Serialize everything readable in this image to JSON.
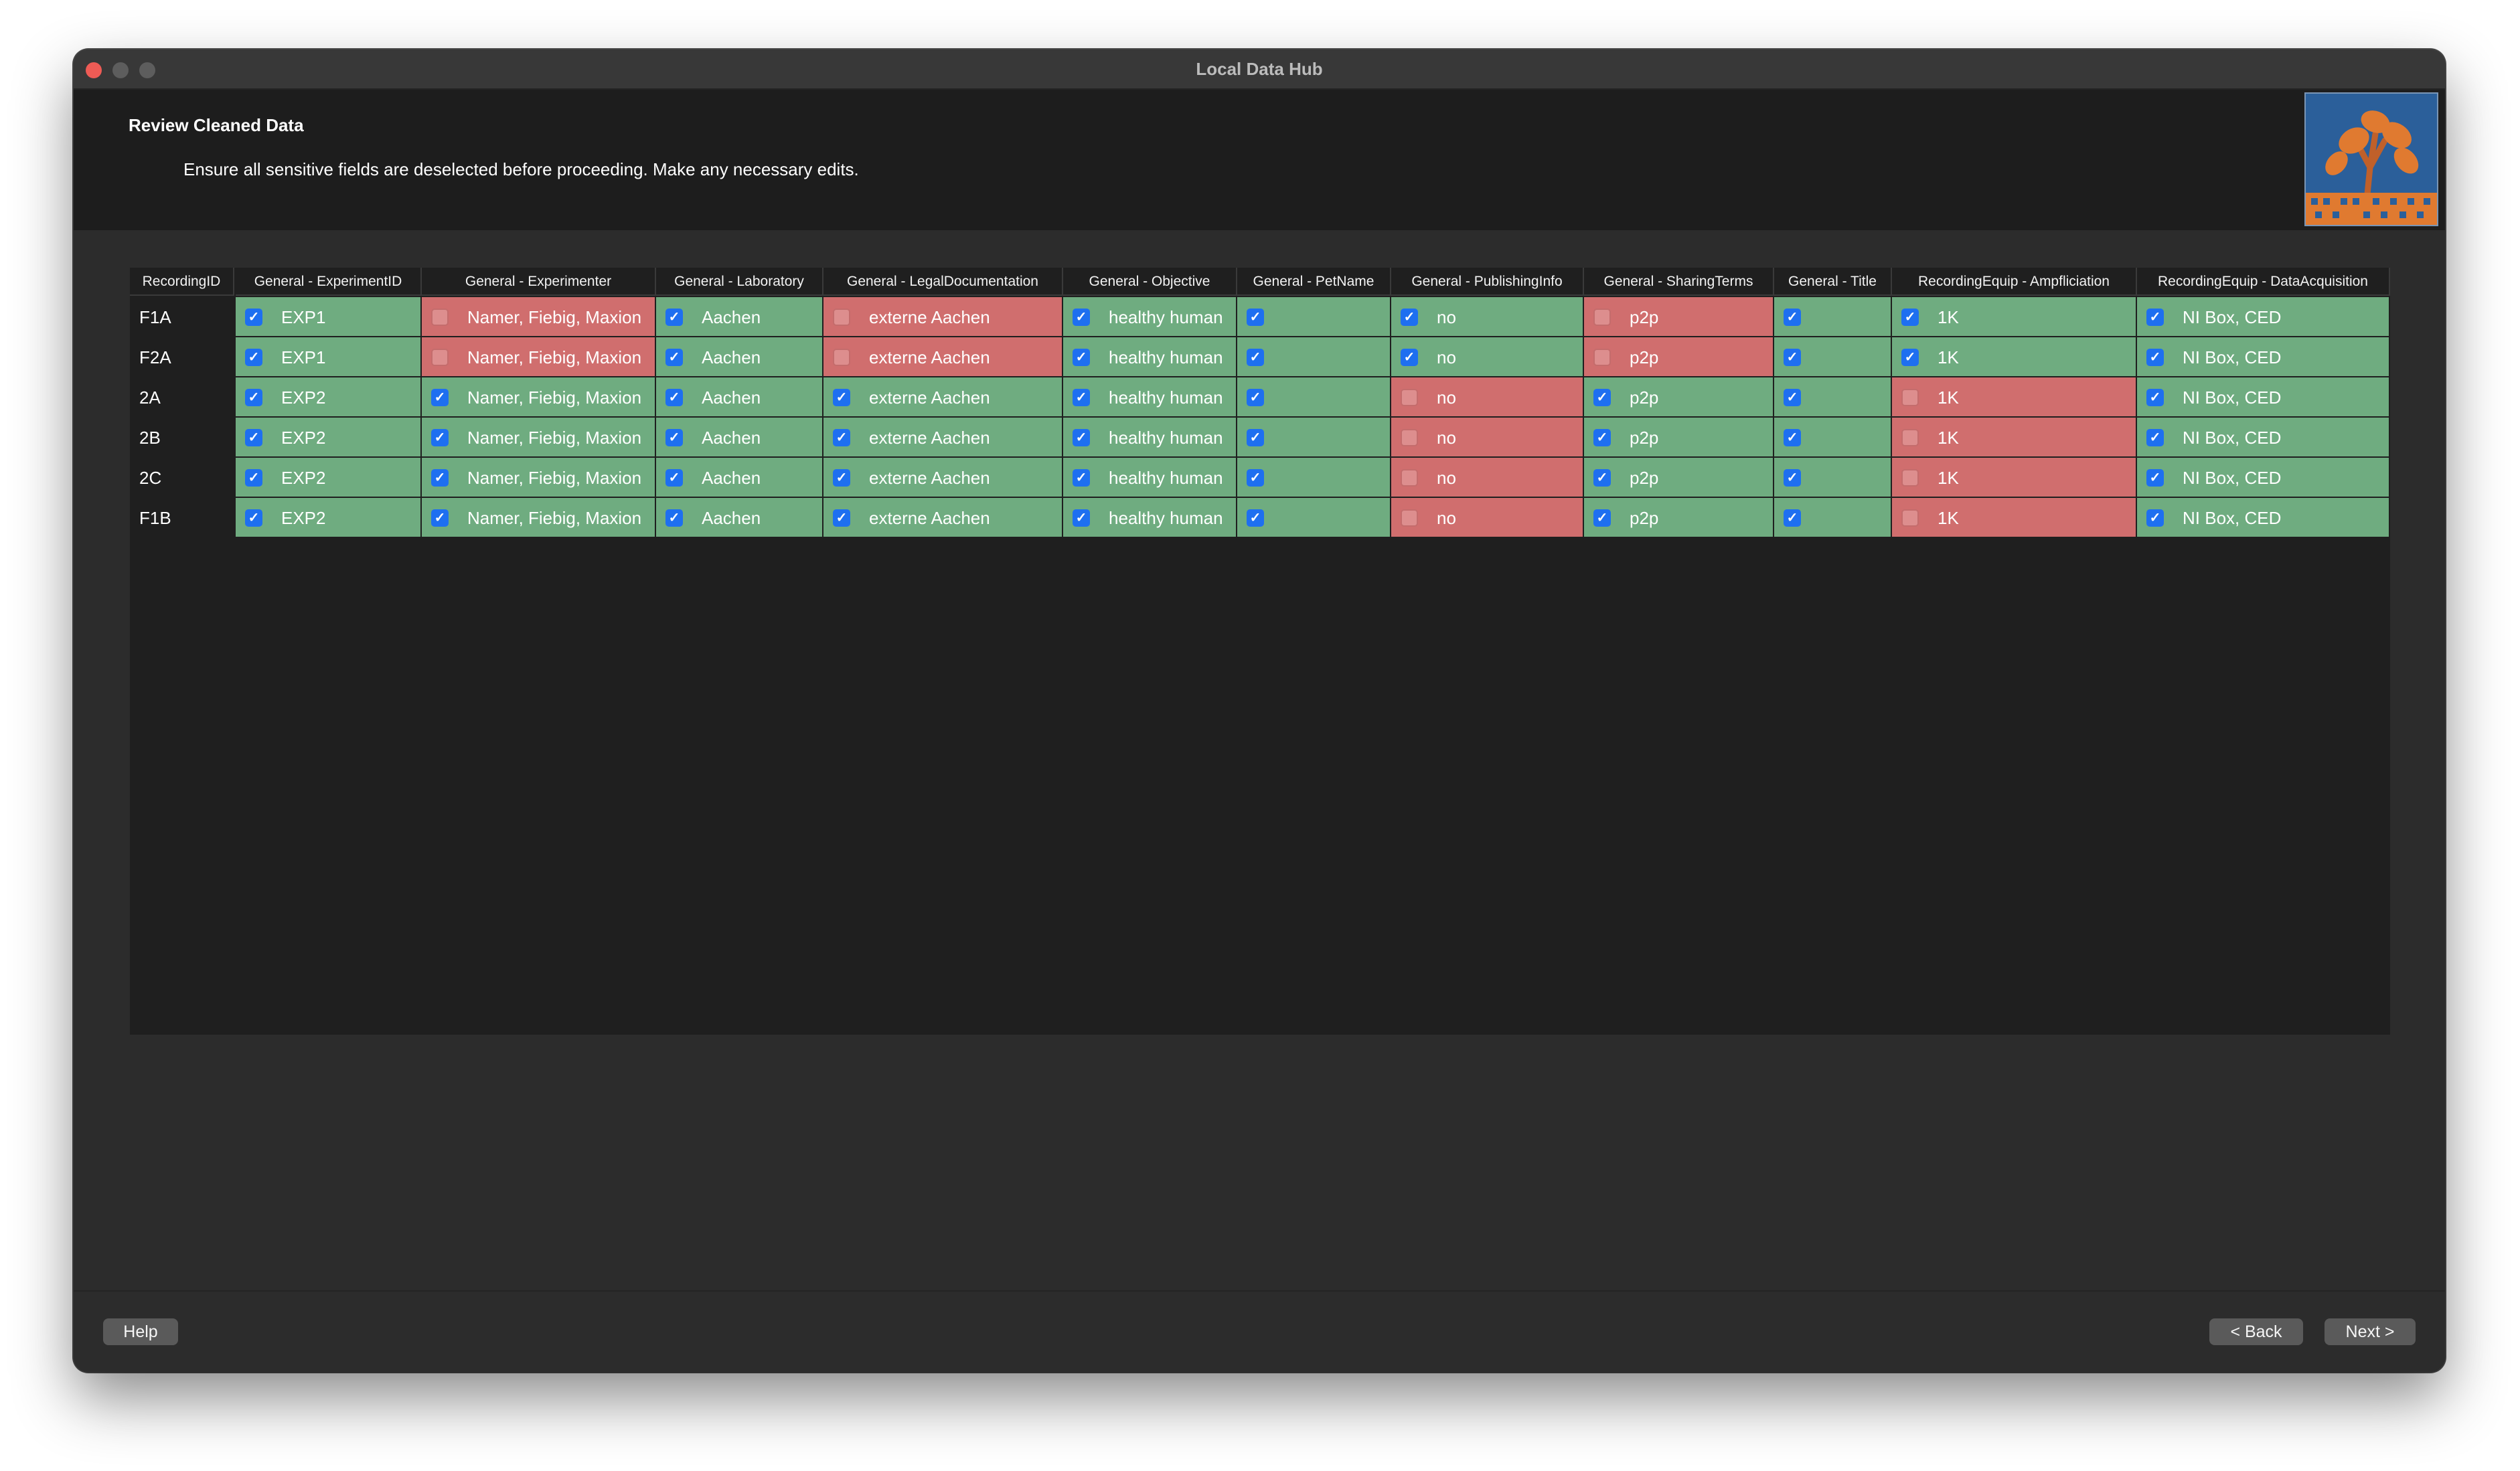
{
  "window": {
    "title": "Local Data Hub"
  },
  "header": {
    "title": "Review Cleaned Data",
    "subtitle": "Ensure all sensitive fields are deselected before proceeding. Make any necessary edits."
  },
  "colors": {
    "selected_cell": "#6fac80",
    "deselected_cell": "#d06e6e",
    "checkbox_on": "#1e6ff0"
  },
  "table": {
    "columns": [
      "RecordingID",
      "General - ExperimentID",
      "General - Experimenter",
      "General - Laboratory",
      "General - LegalDocumentation",
      "General - Objective",
      "General - PetName",
      "General - PublishingInfo",
      "General - SharingTerms",
      "General - Title",
      "RecordingEquip - Ampfliciation",
      "RecordingEquip - DataAcquisition"
    ],
    "rows": [
      {
        "id": "F1A",
        "cells": [
          {
            "text": "EXP1",
            "checked": true
          },
          {
            "text": "Namer, Fiebig, Maxion",
            "checked": false
          },
          {
            "text": "Aachen",
            "checked": true
          },
          {
            "text": "externe Aachen",
            "checked": false
          },
          {
            "text": "healthy human",
            "checked": true
          },
          {
            "text": "",
            "checked": true
          },
          {
            "text": "no",
            "checked": true
          },
          {
            "text": "p2p",
            "checked": false
          },
          {
            "text": "",
            "checked": true
          },
          {
            "text": "1K",
            "checked": true
          },
          {
            "text": "NI Box, CED",
            "checked": true
          }
        ]
      },
      {
        "id": "F2A",
        "cells": [
          {
            "text": "EXP1",
            "checked": true
          },
          {
            "text": "Namer, Fiebig, Maxion",
            "checked": false
          },
          {
            "text": "Aachen",
            "checked": true
          },
          {
            "text": "externe Aachen",
            "checked": false
          },
          {
            "text": "healthy human",
            "checked": true
          },
          {
            "text": "",
            "checked": true
          },
          {
            "text": "no",
            "checked": true
          },
          {
            "text": "p2p",
            "checked": false
          },
          {
            "text": "",
            "checked": true
          },
          {
            "text": "1K",
            "checked": true
          },
          {
            "text": "NI Box, CED",
            "checked": true
          }
        ]
      },
      {
        "id": "2A",
        "cells": [
          {
            "text": "EXP2",
            "checked": true
          },
          {
            "text": "Namer, Fiebig, Maxion",
            "checked": true
          },
          {
            "text": "Aachen",
            "checked": true
          },
          {
            "text": "externe Aachen",
            "checked": true
          },
          {
            "text": "healthy human",
            "checked": true
          },
          {
            "text": "",
            "checked": true
          },
          {
            "text": "no",
            "checked": false
          },
          {
            "text": "p2p",
            "checked": true
          },
          {
            "text": "",
            "checked": true
          },
          {
            "text": "1K",
            "checked": false
          },
          {
            "text": "NI Box, CED",
            "checked": true
          }
        ]
      },
      {
        "id": "2B",
        "cells": [
          {
            "text": "EXP2",
            "checked": true
          },
          {
            "text": "Namer, Fiebig, Maxion",
            "checked": true
          },
          {
            "text": "Aachen",
            "checked": true
          },
          {
            "text": "externe Aachen",
            "checked": true
          },
          {
            "text": "healthy human",
            "checked": true
          },
          {
            "text": "",
            "checked": true
          },
          {
            "text": "no",
            "checked": false
          },
          {
            "text": "p2p",
            "checked": true
          },
          {
            "text": "",
            "checked": true
          },
          {
            "text": "1K",
            "checked": false
          },
          {
            "text": "NI Box, CED",
            "checked": true
          }
        ]
      },
      {
        "id": "2C",
        "cells": [
          {
            "text": "EXP2",
            "checked": true
          },
          {
            "text": "Namer, Fiebig, Maxion",
            "checked": true
          },
          {
            "text": "Aachen",
            "checked": true
          },
          {
            "text": "externe Aachen",
            "checked": true
          },
          {
            "text": "healthy human",
            "checked": true
          },
          {
            "text": "",
            "checked": true
          },
          {
            "text": "no",
            "checked": false
          },
          {
            "text": "p2p",
            "checked": true
          },
          {
            "text": "",
            "checked": true
          },
          {
            "text": "1K",
            "checked": false
          },
          {
            "text": "NI Box, CED",
            "checked": true
          }
        ]
      },
      {
        "id": "F1B",
        "cells": [
          {
            "text": "EXP2",
            "checked": true
          },
          {
            "text": "Namer, Fiebig, Maxion",
            "checked": true
          },
          {
            "text": "Aachen",
            "checked": true
          },
          {
            "text": "externe Aachen",
            "checked": true
          },
          {
            "text": "healthy human",
            "checked": true
          },
          {
            "text": "",
            "checked": true
          },
          {
            "text": "no",
            "checked": false
          },
          {
            "text": "p2p",
            "checked": true
          },
          {
            "text": "",
            "checked": true
          },
          {
            "text": "1K",
            "checked": false
          },
          {
            "text": "NI Box, CED",
            "checked": true
          }
        ]
      }
    ]
  },
  "footer": {
    "help_label": "Help",
    "back_label": "< Back",
    "next_label": "Next >"
  }
}
